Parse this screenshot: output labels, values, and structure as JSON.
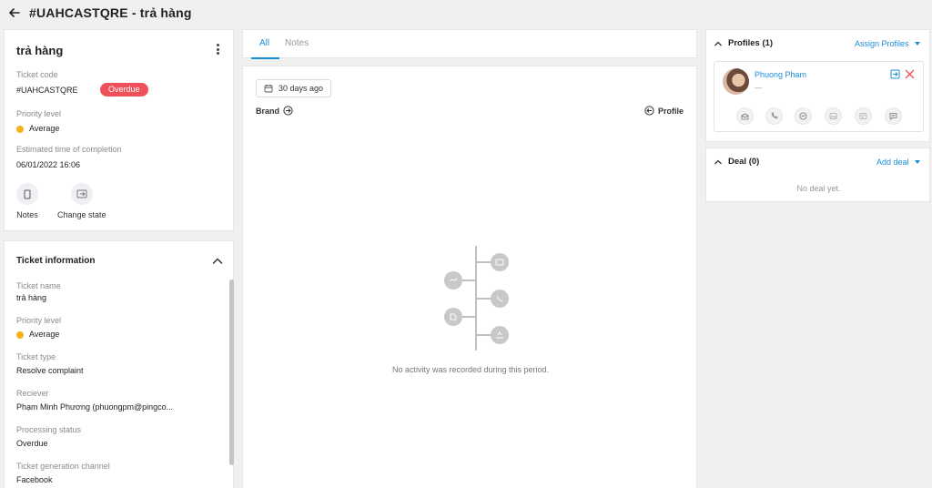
{
  "header": {
    "title": "#UAHCASTQRE - trả hàng"
  },
  "summary": {
    "title": "trả hàng",
    "ticket_code_label": "Ticket code",
    "ticket_code": "#UAHCASTQRE",
    "status_badge": "Overdue",
    "priority_label": "Priority level",
    "priority": "Average",
    "eta_label": "Estimated time of completion",
    "eta": "06/01/2022 16:06",
    "actions": [
      {
        "label": "Notes",
        "icon": "notes-icon"
      },
      {
        "label": "Change state",
        "icon": "change-state-icon"
      }
    ]
  },
  "ticket_info": {
    "heading": "Ticket information",
    "fields": [
      {
        "label": "Ticket name",
        "value": "trả hàng"
      },
      {
        "label": "Priority level",
        "value": "Average"
      },
      {
        "label": "Ticket type",
        "value": "Resolve complaint"
      },
      {
        "label": "Reciever",
        "value": "Phạm Minh Phương (phuongpm@pingco..."
      },
      {
        "label": "Processing status",
        "value": "Overdue"
      },
      {
        "label": "Ticket generation channel",
        "value": "Facebook"
      }
    ]
  },
  "activity": {
    "tabs": [
      {
        "label": "All",
        "active": true
      },
      {
        "label": "Notes",
        "active": false
      }
    ],
    "date_filter": "30 days ago",
    "brand_label": "Brand",
    "profile_label": "Profile",
    "empty_message": "No activity was recorded during this period."
  },
  "profiles": {
    "heading": "Profiles (1)",
    "assign_label": "Assign Profiles",
    "profile_name": "Phuong Pham",
    "profile_sub": "—",
    "channel_icons": [
      "mail-icon",
      "phone-icon",
      "messenger-icon",
      "image-icon",
      "card-icon",
      "chat-icon"
    ]
  },
  "deal": {
    "heading": "Deal (0)",
    "add_label": "Add deal",
    "empty": "No deal yet."
  },
  "colors": {
    "accent": "#1a8ed8",
    "overdue": "#f0505a",
    "priority_average": "#f5b01e",
    "background": "#f0f0ee"
  }
}
